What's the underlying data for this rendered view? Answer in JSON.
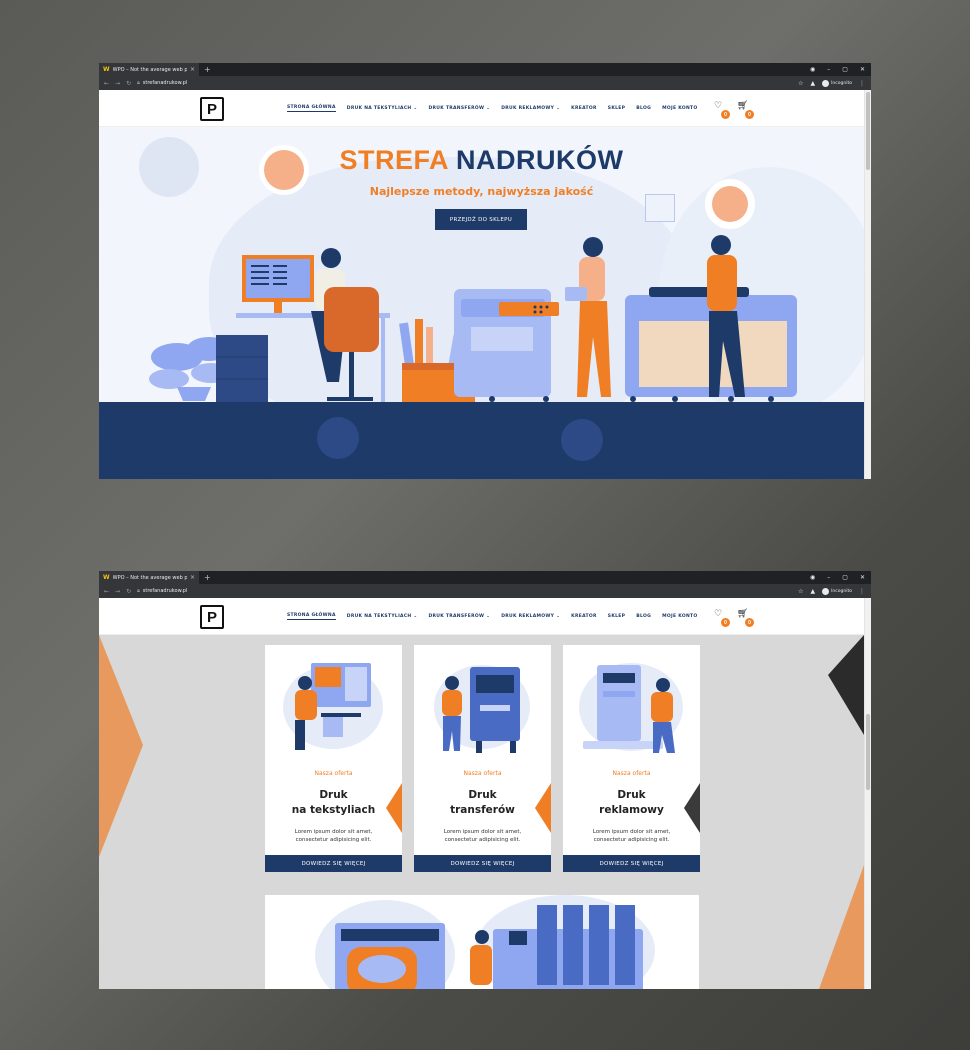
{
  "browser": {
    "tab_title": "WPO – Not the average web pro",
    "tab_favicon": "W",
    "tab_close": "×",
    "new_tab": "+",
    "url": "strefanadrukow.pl",
    "profile_label": "Incognito",
    "icons": [
      "back-icon",
      "forward-icon",
      "reload-icon",
      "lock-icon",
      "star-icon",
      "extension-icon",
      "incognito-icon",
      "menu-dots-icon",
      "minimize-icon",
      "maximize-icon",
      "close-icon"
    ]
  },
  "site": {
    "logo_letter": "P",
    "menu": [
      {
        "label": "STRONA GŁÓWNA",
        "active": true
      },
      {
        "label": "DRUK NA TEKSTYLIACH ⌄"
      },
      {
        "label": "DRUK TRANSFERÓW ⌄"
      },
      {
        "label": "DRUK REKLAMOWY ⌄"
      },
      {
        "label": "KREATOR"
      },
      {
        "label": "SKLEP"
      },
      {
        "label": "BLOG"
      },
      {
        "label": "MOJE KONTO"
      }
    ],
    "wishlist_count": "0",
    "cart_count": "0",
    "icons": [
      "heart-icon",
      "cart-icon"
    ]
  },
  "hero": {
    "title_part1": "STREFA",
    "title_part2": "NADRUKÓW",
    "subtitle": "Najlepsze metody, najwyższa jakość",
    "button": "PRZEJDŹ DO SKLEPU"
  },
  "offer": {
    "cards": [
      {
        "kicker": "Nasza oferta",
        "title_line1": "Druk",
        "title_line2": "na tekstyliach",
        "text_line1": "Lorem ipsum dolor sit amet,",
        "text_line2": "consectetur adipisicing elit.",
        "button": "DOWIEDZ SIĘ WIĘCEJ"
      },
      {
        "kicker": "Nasza oferta",
        "title_line1": "Druk",
        "title_line2": "transferów",
        "text_line1": "Lorem ipsum dolor sit amet,",
        "text_line2": "consectetur adipisicing elit.",
        "button": "DOWIEDZ SIĘ WIĘCEJ"
      },
      {
        "kicker": "Nasza oferta",
        "title_line1": "Druk",
        "title_line2": "reklamowy",
        "text_line1": "Lorem ipsum dolor sit amet,",
        "text_line2": "consectetur adipisicing elit.",
        "button": "DOWIEDZ SIĘ WIĘCEJ"
      }
    ]
  },
  "colors": {
    "navy": "#1e3a68",
    "orange": "#f07e25",
    "light_orange": "#f5b08a",
    "periwinkle": "#8fa6f0",
    "dark": "#2b2b2b"
  }
}
